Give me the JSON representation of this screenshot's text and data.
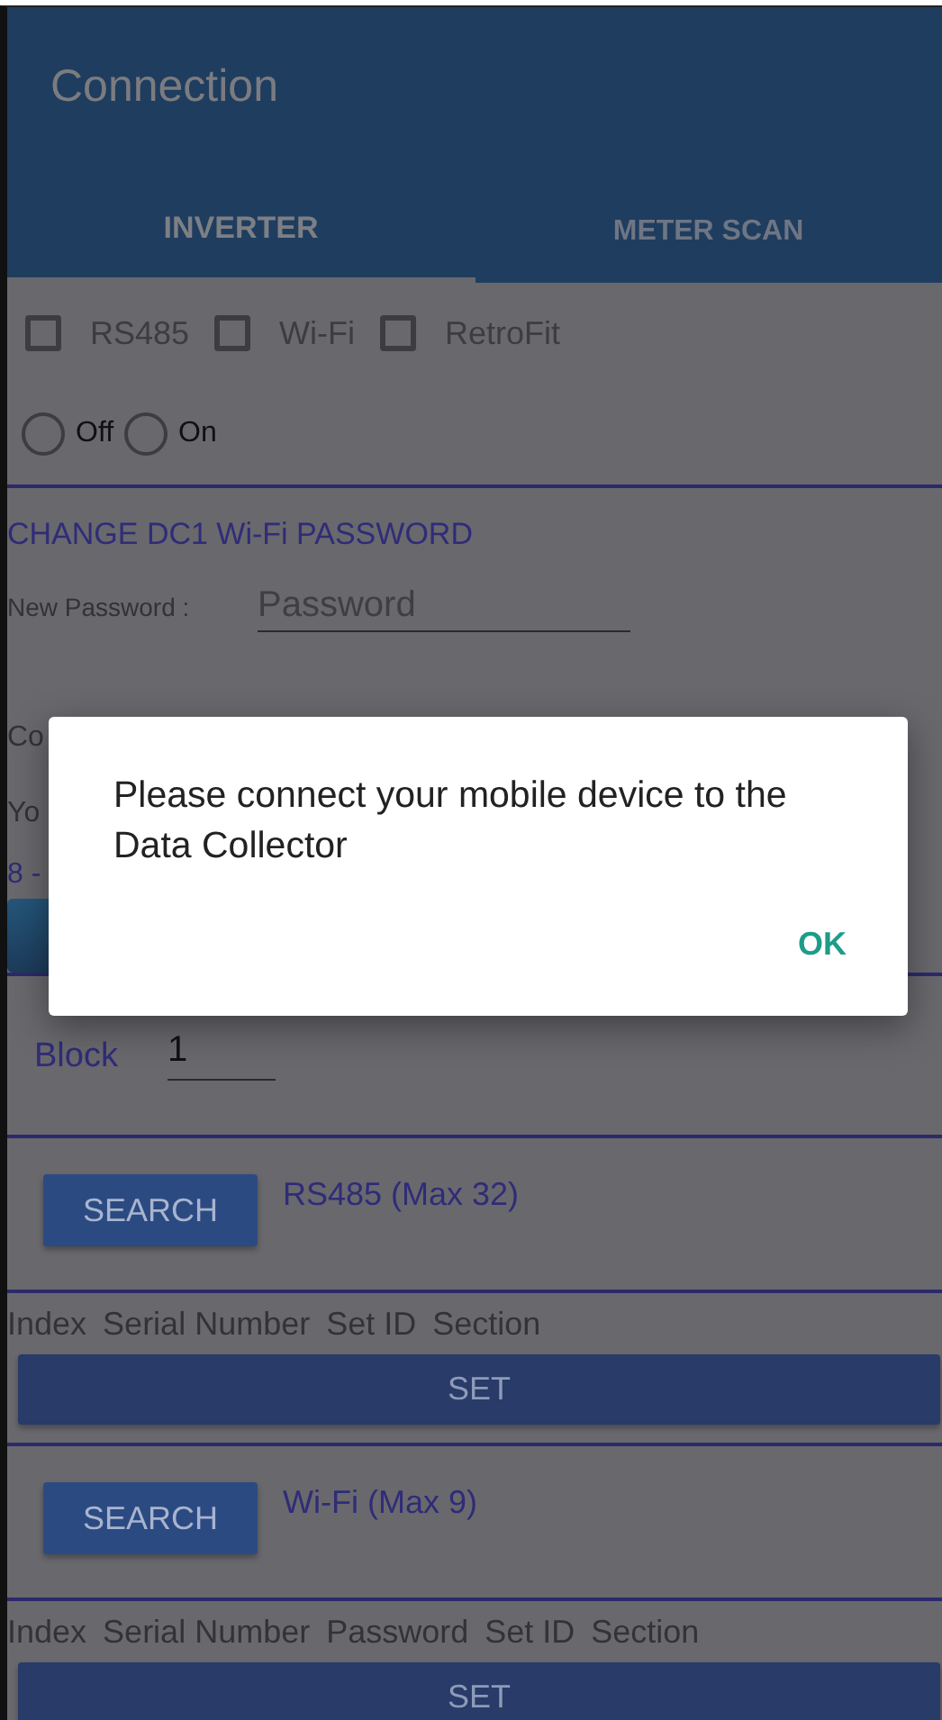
{
  "app_bar": {
    "title": "Connection"
  },
  "tabs": [
    {
      "label": "INVERTER",
      "selected": true
    },
    {
      "label": "METER SCAN",
      "selected": false
    }
  ],
  "options": [
    {
      "label": "RS485",
      "checked": false
    },
    {
      "label": "Wi-Fi",
      "checked": false
    },
    {
      "label": "RetroFit",
      "checked": false
    }
  ],
  "mode": [
    {
      "label": "Off",
      "selected": false
    },
    {
      "label": "On",
      "selected": false
    }
  ],
  "password_section": {
    "title": "CHANGE DC1 Wi-Fi PASSWORD",
    "new_password": {
      "label": "New Password :",
      "placeholder": "Password"
    },
    "fragments": [
      {
        "text": "Co",
        "kind": "label"
      },
      {
        "text": "Yo",
        "kind": "label"
      },
      {
        "text": "8 -",
        "kind": "hint"
      }
    ]
  },
  "block": {
    "label": "Block",
    "value": "1"
  },
  "scans": [
    {
      "button": "SEARCH",
      "title": "RS485 (Max 32)",
      "columns": [
        "Index",
        "Serial Number",
        "Set ID",
        "Section"
      ],
      "action": "SET"
    },
    {
      "button": "SEARCH",
      "title": "Wi-Fi (Max 9)",
      "columns": [
        "Index",
        "Serial Number",
        "Password",
        "Set ID",
        "Section"
      ],
      "action": "SET"
    }
  ],
  "dialog": {
    "message": "Please connect your mobile device to the Data Collector",
    "button": "OK"
  }
}
